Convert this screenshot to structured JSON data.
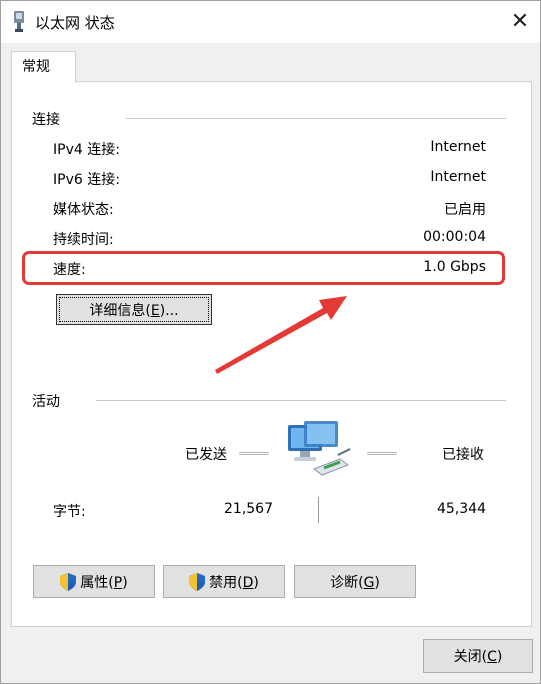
{
  "window": {
    "title": "以太网 状态",
    "close_glyph": "✕"
  },
  "tab": {
    "label": "常规"
  },
  "connection": {
    "section_label": "连接",
    "rows": [
      {
        "label": "IPv4 连接:",
        "value": "Internet"
      },
      {
        "label": "IPv6 连接:",
        "value": "Internet"
      },
      {
        "label": "媒体状态:",
        "value": "已启用"
      },
      {
        "label": "持续时间:",
        "value": "00:00:04"
      },
      {
        "label": "速度:",
        "value": "1.0 Gbps"
      }
    ],
    "details_button": {
      "text": "详细信息(",
      "key": "E",
      "suffix": ")..."
    }
  },
  "activity": {
    "section_label": "活动",
    "sent_label": "已发送",
    "received_label": "已接收",
    "bytes_label": "字节:",
    "bytes_sent": "21,567",
    "bytes_received": "45,344"
  },
  "buttons": {
    "properties": {
      "text": "属性(",
      "key": "P",
      "suffix": ")"
    },
    "disable": {
      "text": "禁用(",
      "key": "D",
      "suffix": ")"
    },
    "diagnose": {
      "text": "诊断(",
      "key": "G",
      "suffix": ")"
    },
    "close": {
      "text": "关闭(",
      "key": "C",
      "suffix": ")"
    }
  },
  "colors": {
    "highlight": "#e53935",
    "arrow": "#e53935",
    "panel_bg": "#ffffff",
    "window_bg": "#f0f0f0"
  },
  "icons": {
    "title_icon": "ethernet-adapter-icon",
    "network_icon": "network-computers-icon",
    "shield_icon": "uac-shield-icon"
  }
}
